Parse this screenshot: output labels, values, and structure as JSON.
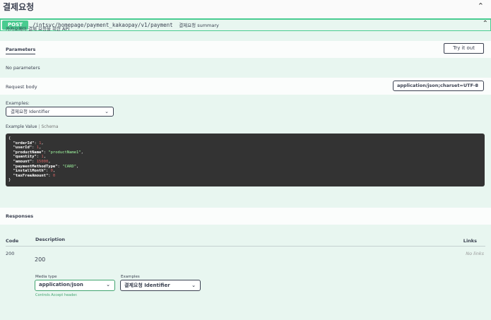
{
  "header": {
    "title": "결제요청",
    "collapse_icon": "chevron-up-icon"
  },
  "operation": {
    "method": "POST",
    "path": "/intsvc/homepage/payment_kakaopay/v1/payment",
    "summary": "결제요청 summary",
    "description": "카카오페이 결제 요청을 위한 API",
    "color": "#49cc90"
  },
  "parameters": {
    "tab_label": "Parameters",
    "try_button": "Try it out",
    "empty_text": "No parameters"
  },
  "request_body": {
    "label": "Request body",
    "content_type": "application/json;charset=UTF-8",
    "examples_label": "Examples:",
    "example_selected": "결제요청 Identifier",
    "tab_example": "Example Value",
    "tab_schema": "Schema",
    "code_open": "{",
    "code_close": "}",
    "code_fields": [
      {
        "key": "\"orderId\"",
        "value": "1",
        "type": "n"
      },
      {
        "key": "\"userId\"",
        "value": "1",
        "type": "n"
      },
      {
        "key": "\"productName\"",
        "value": "\"productName1\"",
        "type": "s"
      },
      {
        "key": "\"quantity\"",
        "value": "1",
        "type": "n"
      },
      {
        "key": "\"amount\"",
        "value": "15000",
        "type": "n"
      },
      {
        "key": "\"paymentMethodType\"",
        "value": "\"CARD\"",
        "type": "s"
      },
      {
        "key": "\"installMonth\"",
        "value": "0",
        "type": "n"
      },
      {
        "key": "\"taxFreeAmount\"",
        "value": "0",
        "type": "n"
      }
    ]
  },
  "responses": {
    "label": "Responses",
    "col_code": "Code",
    "col_description": "Description",
    "col_links": "Links",
    "row": {
      "code": "200",
      "description": "200",
      "links": "No links",
      "media_type_label": "Media type",
      "media_type": "application/json",
      "media_hint": "Controls Accept header.",
      "examples_label": "Examples",
      "example_selected": "결제요청 Identifier"
    }
  }
}
